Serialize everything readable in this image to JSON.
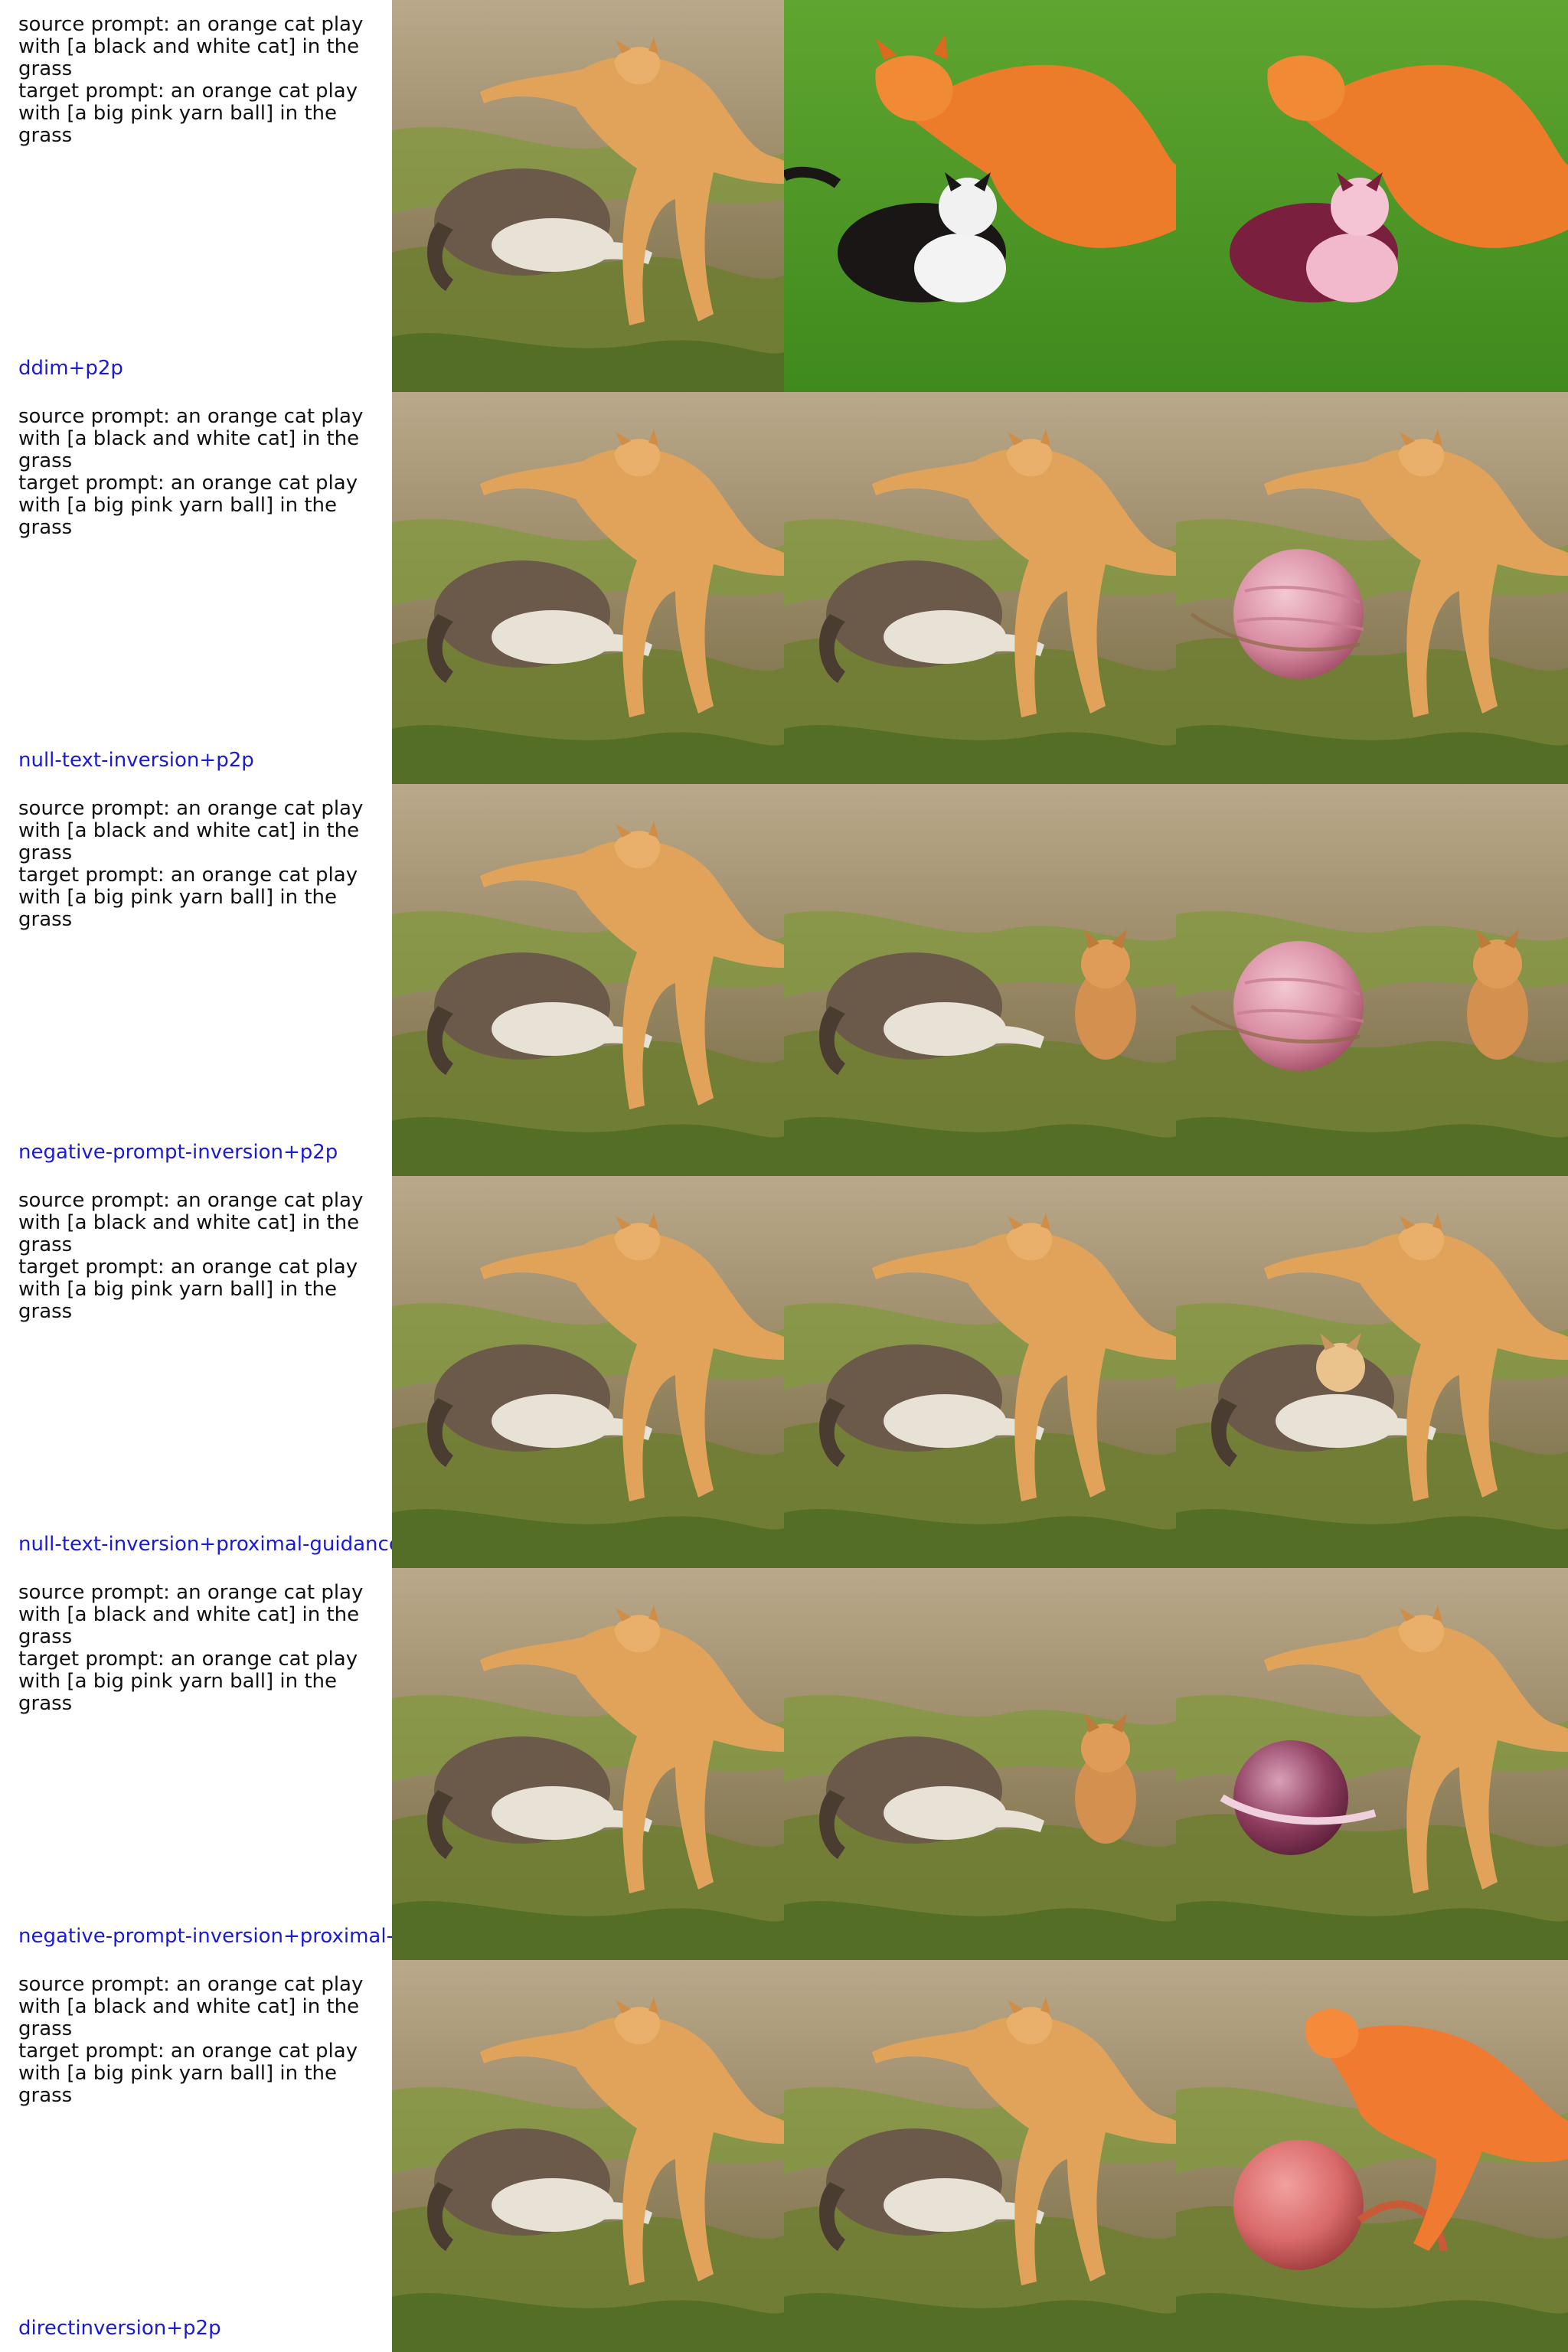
{
  "grid": {
    "rows": [
      {
        "source_prompt": "source prompt: an orange cat play with [a black and white cat] in the grass",
        "target_prompt": "target prompt: an orange cat play with [a big pink yarn ball] in the grass",
        "method": "ddim+p2p",
        "images": [
          "source-photo",
          "cats-on-green-grass",
          "pink-edited-cat-on-green-grass"
        ]
      },
      {
        "source_prompt": "source prompt: an orange cat play with [a black and white cat] in the grass",
        "target_prompt": "target prompt: an orange cat play with [a big pink yarn ball] in the grass",
        "method": "null-text-inversion+p2p",
        "images": [
          "source-photo",
          "reconstructed-photo",
          "pink-yarn-ball-edit"
        ]
      },
      {
        "source_prompt": "source prompt: an orange cat play with [a black and white cat] in the grass",
        "target_prompt": "target prompt: an orange cat play with [a big pink yarn ball] in the grass",
        "method": "negative-prompt-inversion+p2p",
        "images": [
          "source-photo",
          "reconstruction-small-cat",
          "pink-ball-small-cat-edit"
        ]
      },
      {
        "source_prompt": "source prompt: an orange cat play with [a black and white cat] in the grass",
        "target_prompt": "target prompt: an orange cat play with [a big pink yarn ball] in the grass",
        "method": "null-text-inversion+proximal-guidance",
        "images": [
          "source-photo",
          "reconstructed-photo",
          "two-cats-edit"
        ]
      },
      {
        "source_prompt": "source prompt: an orange cat play with [a black and white cat] in the grass",
        "target_prompt": "target prompt: an orange cat play with [a big pink yarn ball] in the grass",
        "method": "negative-prompt-inversion+proximal-guidance",
        "images": [
          "source-photo",
          "reconstruction-small-cat",
          "pink-ball-edit"
        ]
      },
      {
        "source_prompt": "source prompt: an orange cat play with [a black and white cat] in the grass",
        "target_prompt": "target prompt: an orange cat play with [a big pink yarn ball] in the grass",
        "method": "directinversion+p2p",
        "images": [
          "source-photo",
          "reconstructed-photo",
          "pink-yarn-ball-edit"
        ]
      }
    ]
  },
  "colors": {
    "method_label": "#1a1ad6",
    "prompt_text": "#111111",
    "background": "#ffffff"
  }
}
